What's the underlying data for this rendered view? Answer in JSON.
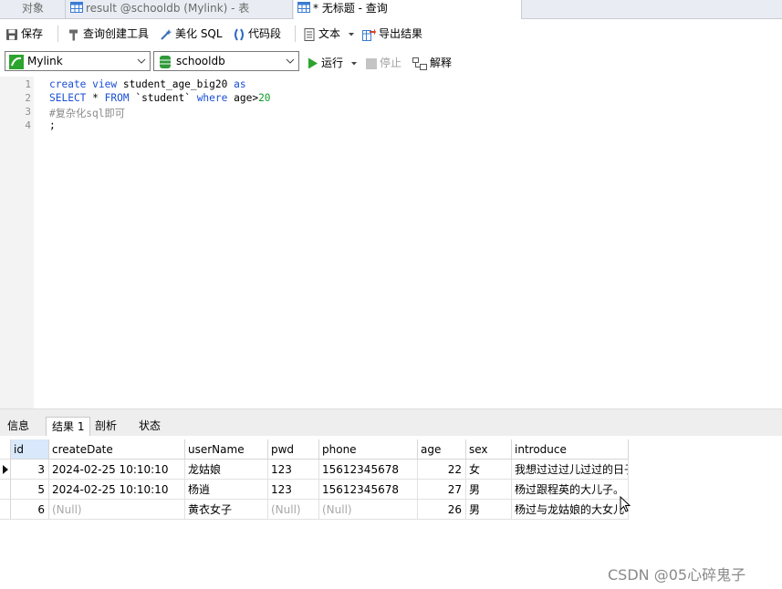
{
  "tabs": [
    {
      "label": "对象"
    },
    {
      "label": "result @schooldb (Mylink) - 表"
    },
    {
      "label": "* 无标题 - 查询"
    }
  ],
  "toolbar": {
    "save": "保存",
    "query_builder": "查询创建工具",
    "beautify": "美化 SQL",
    "snippet": "代码段",
    "text": "文本",
    "export": "导出结果"
  },
  "selectors": {
    "connection": "Mylink",
    "database": "schooldb",
    "run": "运行",
    "stop": "停止",
    "explain": "解释"
  },
  "editor": {
    "line_numbers": [
      "1",
      "2",
      "3",
      "4"
    ],
    "l1_kw1": "create view",
    "l1_name": " student_age_big20 ",
    "l1_kw2": "as",
    "l2_kw1": "SELECT",
    "l2_mid": " * ",
    "l2_kw2": "FROM",
    "l2_tbl": " `student` ",
    "l2_kw3": "where",
    "l2_col": " age>",
    "l2_num": "20",
    "l3": "#复杂化sql即可",
    "l4": ";"
  },
  "result_tabs": [
    "信息",
    "结果 1",
    "剖析",
    "状态"
  ],
  "grid": {
    "columns": [
      "id",
      "createDate",
      "userName",
      "pwd",
      "phone",
      "age",
      "sex",
      "introduce"
    ],
    "rows": [
      [
        "3",
        "2024-02-25 10:10:10",
        "龙姑娘",
        "123",
        "15612345678",
        "22",
        "女",
        "我想过过过儿过过的日子"
      ],
      [
        "5",
        "2024-02-25 10:10:10",
        "杨逍",
        "123",
        "15612345678",
        "27",
        "男",
        "杨过跟程英的大儿子。"
      ],
      [
        "6",
        "(Null)",
        "黄衣女子",
        "(Null)",
        "(Null)",
        "26",
        "男",
        "杨过与龙姑娘的大女儿"
      ]
    ]
  },
  "watermark": "CSDN @05心碎鬼子",
  "colors": {
    "keyword": "#1a4fd6",
    "number": "#0f9b2a",
    "comment": "#8a8a8a",
    "run_green": "#2da42d",
    "db_green": "#2e9a3a"
  }
}
